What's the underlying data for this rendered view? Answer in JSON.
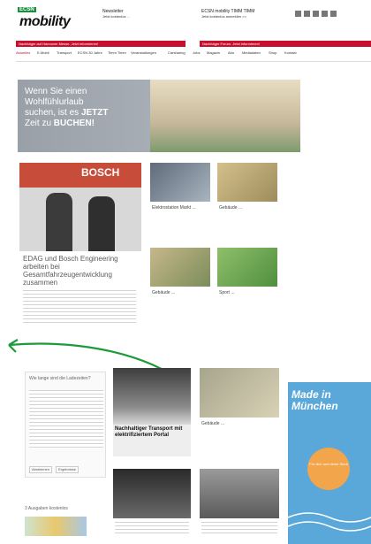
{
  "header": {
    "logo_badge": "ECSN",
    "logo_text": "mobility",
    "newsletter_title": "Newsletter",
    "newsletter_sub": "Jetzt kostenlos ...",
    "promo_title": "ECSN mobility TIMM TIMM",
    "promo_sub": "Jetzt kostenlos anmelden >>",
    "social": [
      "rss",
      "twitter",
      "facebook",
      "xing",
      "mail"
    ]
  },
  "redbars": {
    "left": "Nachfolger auf Hannover Messe. Jetzt informieren!",
    "right": "Nachfolger Forum. Jetzt informieren!"
  },
  "nav": {
    "items": [
      "Aktuelles",
      "E-Mobil",
      "Transport",
      "ECSN 30 Jahre",
      "Timm Timm",
      "Veranstaltungen",
      "Carsharing",
      "Jobs",
      "Magazin",
      "Abo",
      "Mediadaten",
      "Shop",
      "Kontakt"
    ]
  },
  "hero": {
    "line1": "Wenn Sie einen",
    "line2": "Wohlfühlurlaub",
    "line3": "suchen, ist es",
    "highlight1": "JETZT",
    "line4": "Zeit zu",
    "highlight2": "BUCHEN!"
  },
  "main_article": {
    "photo_label": "BOSCH",
    "title": "EDAG und Bosch Engineering arbeiten bei Gesamtfahrzeugentwicklung zusammen"
  },
  "cards_top": [
    {
      "title": "Elektrostation Markt ...",
      "kind": "photo"
    },
    {
      "title": "Gebäude ...",
      "kind": "photo"
    },
    {
      "title": "Gebäude ...",
      "kind": "photo"
    },
    {
      "title": "Sport ...",
      "kind": "photo"
    }
  ],
  "feature": {
    "title": "Nachhaltiger Transport mit elektrifiziertem Portal",
    "subtitle": ""
  },
  "sidebar": {
    "intro": "Wie lange sind die Ladezeiten?",
    "btn1": "Abstimmen",
    "btn2": "Ergebnisse",
    "issues_title": "3 Ausgaben kostenlos"
  },
  "ad": {
    "line1": "Made in",
    "line2": "München",
    "circle_text": "Für dich und deine Stadt"
  }
}
